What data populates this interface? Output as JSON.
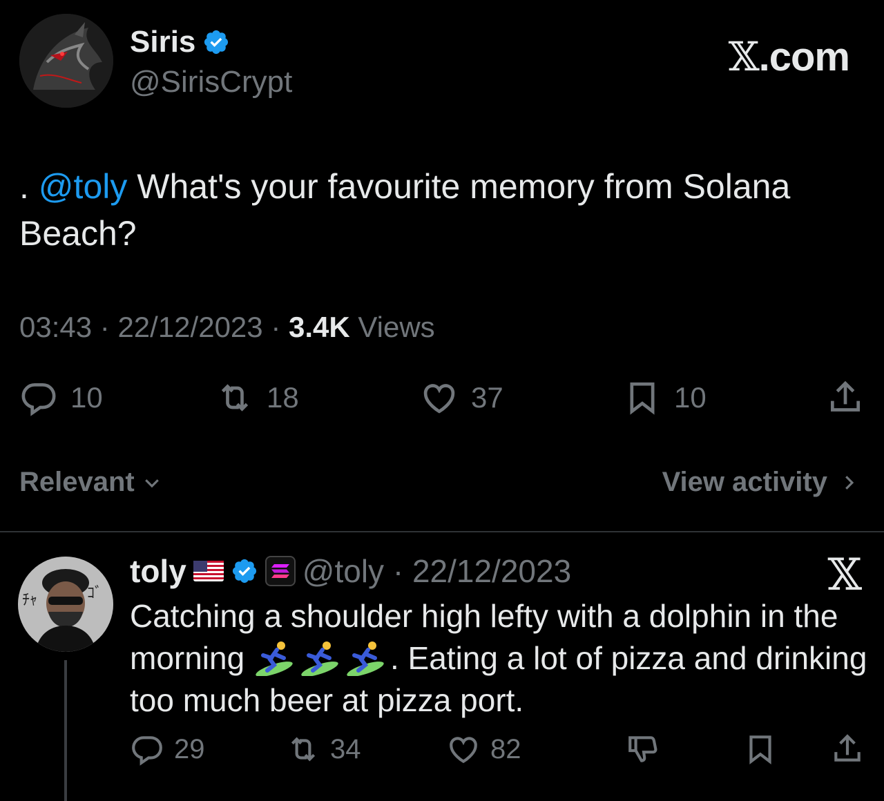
{
  "tweet": {
    "author_name": "Siris",
    "author_handle": "@SirisCrypt",
    "brand": ".com",
    "text_prefix": ". ",
    "mention": "@toly",
    "text_body": " What's your favourite memory from Solana Beach?",
    "time": "03:43",
    "date": "22/12/2023",
    "views_count": "3.4K",
    "views_label": "Views",
    "replies": "10",
    "reposts": "18",
    "likes": "37",
    "bookmarks": "10"
  },
  "sort": {
    "label": "Relevant",
    "view_activity": "View activity"
  },
  "reply": {
    "author_name": "toly",
    "handle_date": "@toly · 22/12/2023",
    "text_line1": "Catching a shoulder high lefty with a dolphin in the morning",
    "text_line2": ". Eating a lot of pizza and drinking too much beer at pizza port.",
    "replies": "29",
    "reposts": "34",
    "likes": "82"
  },
  "colors": {
    "background": "#000000",
    "accent": "#1d9bf0",
    "text_primary": "#e7e9ea",
    "text_secondary": "#71767b",
    "divider": "#2f3336"
  },
  "icons": [
    "verified-badge-icon",
    "x-logo-icon",
    "reply-icon",
    "repost-icon",
    "like-icon",
    "bookmark-icon",
    "share-icon",
    "chevron-down-icon",
    "chevron-right-icon",
    "us-flag-icon",
    "solana-badge-icon",
    "surfer-emoji-icon",
    "dislike-icon"
  ]
}
